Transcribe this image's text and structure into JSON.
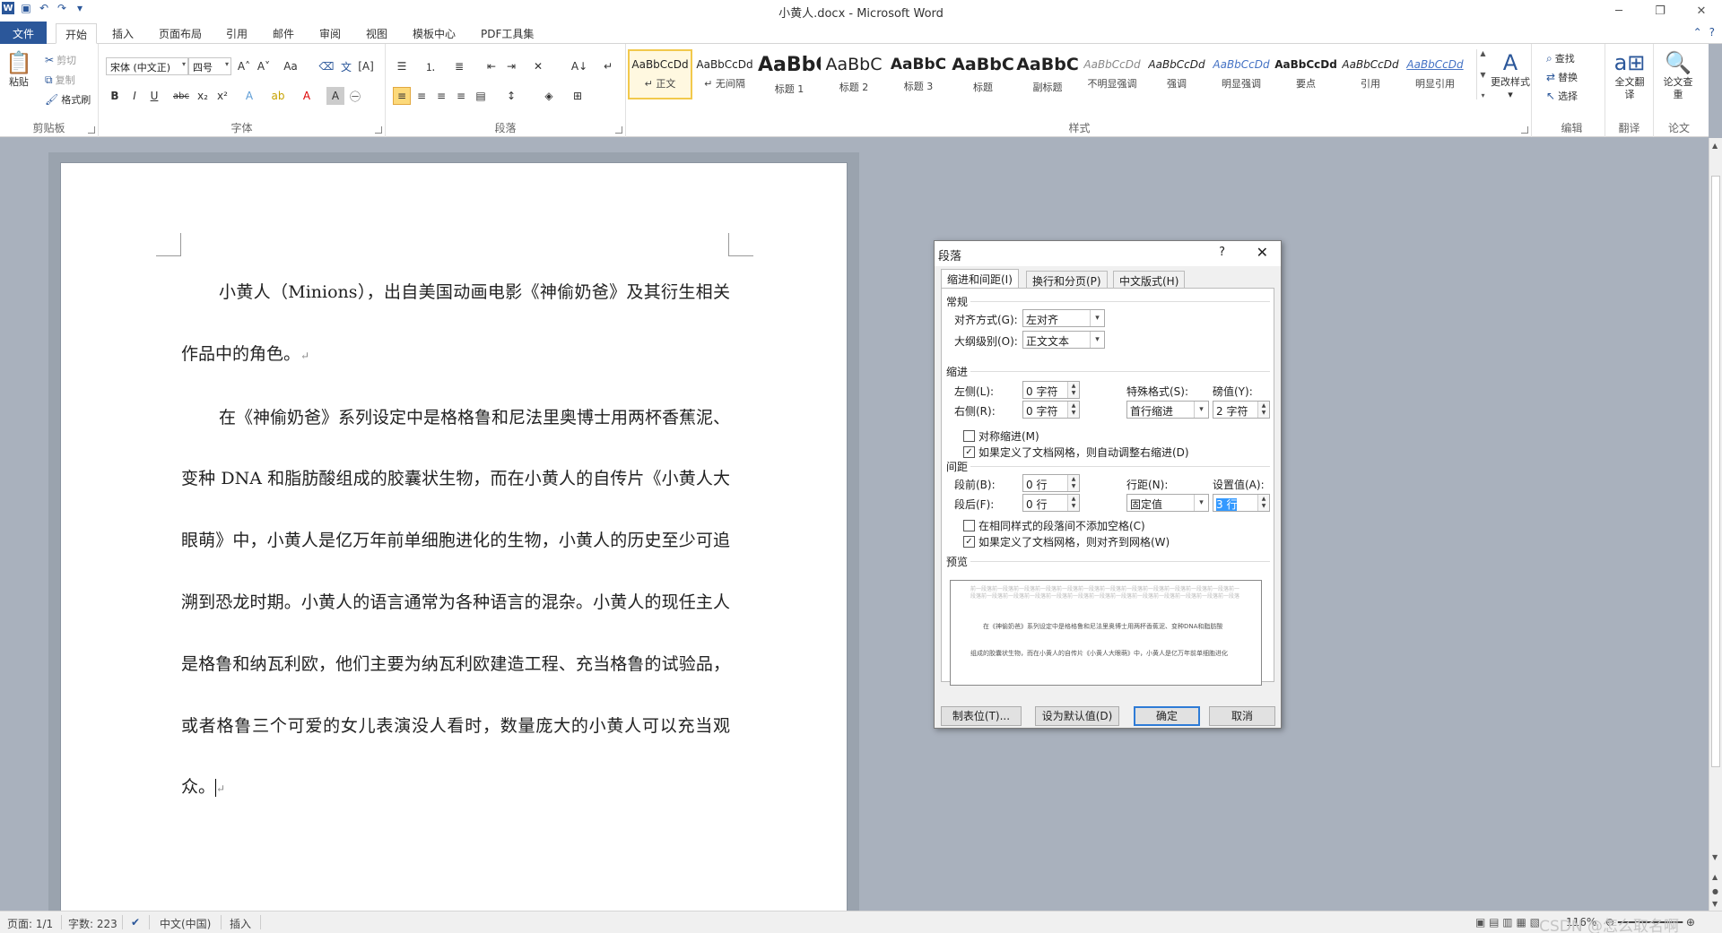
{
  "app": {
    "window_title": "小黄人.docx - Microsoft Word",
    "file_tab": "文件",
    "tabs": [
      "开始",
      "插入",
      "页面布局",
      "引用",
      "邮件",
      "审阅",
      "视图",
      "模板中心",
      "PDF工具集"
    ]
  },
  "ribbon": {
    "clipboard": {
      "label": "剪贴板",
      "paste": "粘贴",
      "cut": "剪切",
      "copy": "复制",
      "format_painter": "格式刷"
    },
    "font": {
      "label": "字体",
      "font_name": "宋体 (中文正)",
      "font_size": "四号"
    },
    "paragraph": {
      "label": "段落"
    },
    "styles": {
      "label": "样式",
      "items": [
        {
          "preview": "AaBbCcDd",
          "name": "↵ 正文"
        },
        {
          "preview": "AaBbCcDd",
          "name": "↵ 无间隔"
        },
        {
          "preview": "AaBbC",
          "name": "标题 1"
        },
        {
          "preview": "AaBbC",
          "name": "标题 2"
        },
        {
          "preview": "AaBbC",
          "name": "标题 3"
        },
        {
          "preview": "AaBbC",
          "name": "标题"
        },
        {
          "preview": "AaBbC",
          "name": "副标题"
        },
        {
          "preview": "AaBbCcDd",
          "name": "不明显强调"
        },
        {
          "preview": "AaBbCcDd",
          "name": "强调"
        },
        {
          "preview": "AaBbCcDd",
          "name": "明显强调"
        },
        {
          "preview": "AaBbCcDd",
          "name": "要点"
        },
        {
          "preview": "AaBbCcDd",
          "name": "引用"
        },
        {
          "preview": "AaBbCcDd",
          "name": "明显引用"
        }
      ],
      "change_styles": "更改样式"
    },
    "editing": {
      "label": "编辑",
      "find": "查找",
      "replace": "替换",
      "select": "选择"
    },
    "translate": {
      "label": "翻译",
      "full_translate": "全文翻译"
    },
    "paper": {
      "label": "论文",
      "check": "论文查重"
    }
  },
  "document": {
    "paragraphs": [
      "小黄人（Minions），出自美国动画电影《神偷奶爸》及其衍生相关作品中的角色。",
      "在《神偷奶爸》系列设定中是格格鲁和尼法里奥博士用两杯香蕉泥、变种 DNA 和脂肪酸组成的胶囊状生物，而在小黄人的自传片《小黄人大眼萌》中，小黄人是亿万年前单细胞进化的生物，小黄人的历史至少可追溯到恐龙时期。小黄人的语言通常为各种语言的混杂。小黄人的现任主人是格鲁和纳瓦利欧，他们主要为纳瓦利欧建造工程、充当格鲁的试验品，或者格鲁三个可爱的女儿表演没人看时，数量庞大的小黄人可以充当观众。"
    ],
    "para_mark": "↵"
  },
  "status": {
    "page": "页面: 1/1",
    "words": "字数: 223",
    "language": "中文(中国)",
    "mode": "插入",
    "zoom": "116%",
    "watermark": "CSDN @怎么取名啊"
  },
  "dialog": {
    "title": "段落",
    "help": "?",
    "tabs": [
      "缩进和间距(I)",
      "换行和分页(P)",
      "中文版式(H)"
    ],
    "general": {
      "section": "常规",
      "align_label": "对齐方式(G):",
      "align_value": "左对齐",
      "outline_label": "大纲级别(O):",
      "outline_value": "正文文本"
    },
    "indent": {
      "section": "缩进",
      "left_label": "左侧(L):",
      "left_value": "0 字符",
      "right_label": "右侧(R):",
      "right_value": "0 字符",
      "special_label": "特殊格式(S):",
      "special_value": "首行缩进",
      "by_label": "磅值(Y):",
      "by_value": "2 字符",
      "mirror": "对称缩进(M)",
      "auto_right": "如果定义了文档网格，则自动调整右缩进(D)"
    },
    "spacing": {
      "section": "间距",
      "before_label": "段前(B):",
      "before_value": "0 行",
      "after_label": "段后(F):",
      "after_value": "0 行",
      "line_label": "行距(N):",
      "line_value": "固定值",
      "at_label": "设置值(A):",
      "at_value": "3 行",
      "no_space": "在相同样式的段落间不添加空格(C)",
      "snap_grid": "如果定义了文档网格，则对齐到网格(W)"
    },
    "preview": {
      "section": "预览",
      "prev_text": "前一段落前一段落前一段落前一段落前一段落前一段落前一段落前一段落前一段落前一段落前一段落前一段落前一段落前一段落前一段落前一段落前一段落前一段落前一段落前一段落前一段落前一段落前一段落前一段落前一段落",
      "sample1": "在《神偷奶爸》系列设定中是格格鲁和尼法里奥博士用两杯香蕉泥、变种DNA和脂肪酸",
      "sample2": "组成的胶囊状生物，而在小黄人的自传片《小黄人大眼萌》中，小黄人是亿万年前单细胞进化"
    },
    "buttons": {
      "tabs": "制表位(T)...",
      "default": "设为默认值(D)",
      "ok": "确定",
      "cancel": "取消"
    }
  }
}
